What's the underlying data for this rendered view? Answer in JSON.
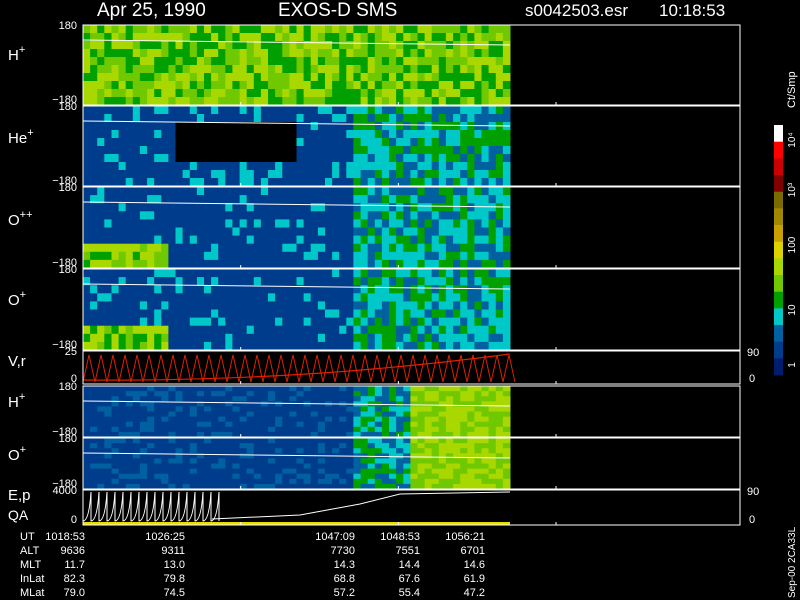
{
  "header": {
    "date": "Apr 25, 1990",
    "instrument": "EXOS-D SMS",
    "file": "s0042503.esr",
    "time": "10:18:53"
  },
  "side_label": "Sep-00  2CA33L",
  "colorbar": {
    "label": "Ct/Smp",
    "ticks": [
      "10⁴",
      "10³",
      "100",
      "10",
      "1"
    ],
    "colors": [
      "#ffffff",
      "#ff0000",
      "#cc0000",
      "#800000",
      "#7a6a00",
      "#a08800",
      "#c8a000",
      "#dcd200",
      "#a8d800",
      "#70c800",
      "#00a000",
      "#00c8c8",
      "#0060a0",
      "#003c8c",
      "#001c6c"
    ]
  },
  "chart_data": {
    "type": "heatmap",
    "time_axis": {
      "label": "UT",
      "ticks": [
        "1018:53",
        "1026:25",
        "1047:09",
        "1048:53",
        "1056:21"
      ]
    },
    "panels": [
      {
        "label_main": "H",
        "label_sup": "+",
        "ylim": [
          -180,
          180
        ],
        "ticks": [
          "180",
          "−180"
        ]
      },
      {
        "label_main": "He",
        "label_sup": "+",
        "ylim": [
          -180,
          180
        ],
        "ticks": [
          "180",
          "−180"
        ]
      },
      {
        "label_main": "O",
        "label_sup": "++",
        "ylim": [
          -180,
          180
        ],
        "ticks": [
          "180",
          "−180"
        ]
      },
      {
        "label_main": "O",
        "label_sup": "+",
        "ylim": [
          -180,
          180
        ],
        "ticks": [
          "180",
          "−180"
        ]
      },
      {
        "label_main": "V,r",
        "label_sup": "",
        "ylim": [
          0,
          25
        ],
        "ticks": [
          "25",
          "0"
        ],
        "right_ticks": [
          "90",
          "0"
        ]
      },
      {
        "label_main": "H",
        "label_sup": "+",
        "ylim": [
          -180,
          180
        ],
        "ticks": [
          "180",
          "−180"
        ]
      },
      {
        "label_main": "O",
        "label_sup": "+",
        "ylim": [
          -180,
          180
        ],
        "ticks": [
          "180",
          "−180"
        ]
      },
      {
        "label_main": "E,p",
        "label_sup": "",
        "label2": "QA",
        "ylim": [
          0,
          4000
        ],
        "ticks": [
          "4000",
          "0"
        ],
        "right_ticks": [
          "90",
          "0"
        ]
      }
    ],
    "ephemeris": {
      "rows": [
        {
          "label": "UT",
          "values": [
            "1018:53",
            "1026:25",
            "1047:09",
            "1048:53",
            "1056:21"
          ]
        },
        {
          "label": "ALT",
          "values": [
            "9636",
            "9311",
            "7730",
            "7551",
            "6701"
          ]
        },
        {
          "label": "MLT",
          "values": [
            "11.7",
            "13.0",
            "14.3",
            "14.4",
            "14.6"
          ]
        },
        {
          "label": "InLat",
          "values": [
            "82.3",
            "79.8",
            "68.8",
            "67.6",
            "61.9"
          ]
        },
        {
          "label": "MLat",
          "values": [
            "79.0",
            "74.5",
            "57.2",
            "55.4",
            "47.2"
          ]
        }
      ]
    }
  }
}
